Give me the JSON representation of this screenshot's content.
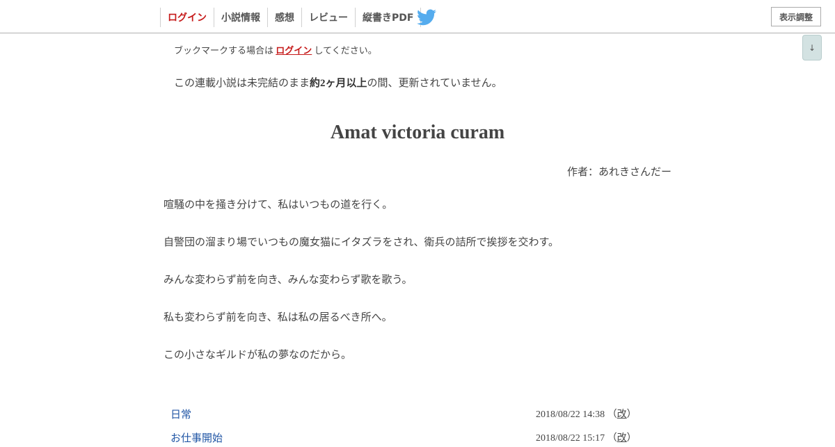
{
  "nav": {
    "items": [
      {
        "label": "ログイン"
      },
      {
        "label": "小説情報"
      },
      {
        "label": "感想"
      },
      {
        "label": "レビュー"
      },
      {
        "label": "縦書きPDF"
      }
    ],
    "display_adjust": "表示調整",
    "scroll_down": "↓"
  },
  "notice": {
    "before": "ブックマークする場合は ",
    "link": "ログイン",
    "after": " してください。"
  },
  "status": {
    "before": "この連載小説は未完結のまま",
    "bold": "約2ヶ月以上",
    "after": "の間、更新されていません。"
  },
  "novel": {
    "title": "Amat victoria curam",
    "author": "作者：あれきさんだー"
  },
  "synopsis": [
    "喧騒の中を掻き分けて、私はいつもの道を行く。",
    "自警団の溜まり場でいつもの魔女猫にイタズラをされ、衛兵の詰所で挨拶を交わす。",
    "みんな変わらず前を向き、みんな変わらず歌を歌う。",
    "私も変わらず前を向き、私は私の居るべき所へ。",
    "この小さなギルドが私の夢なのだから。"
  ],
  "episodes": [
    {
      "title": "日常",
      "date": "2018/08/22 14:38",
      "rev_open": "（",
      "rev": "改",
      "rev_close": "）"
    },
    {
      "title": "お仕事開始",
      "date": "2018/08/22 15:17",
      "rev_open": "（",
      "rev": "改",
      "rev_close": "）"
    }
  ],
  "colors": {
    "accent_login": "#c61a1a",
    "link_blue": "#2156a5",
    "twitter_blue": "#55acee"
  },
  "icons": {
    "twitter": "twitter-bird-icon"
  }
}
